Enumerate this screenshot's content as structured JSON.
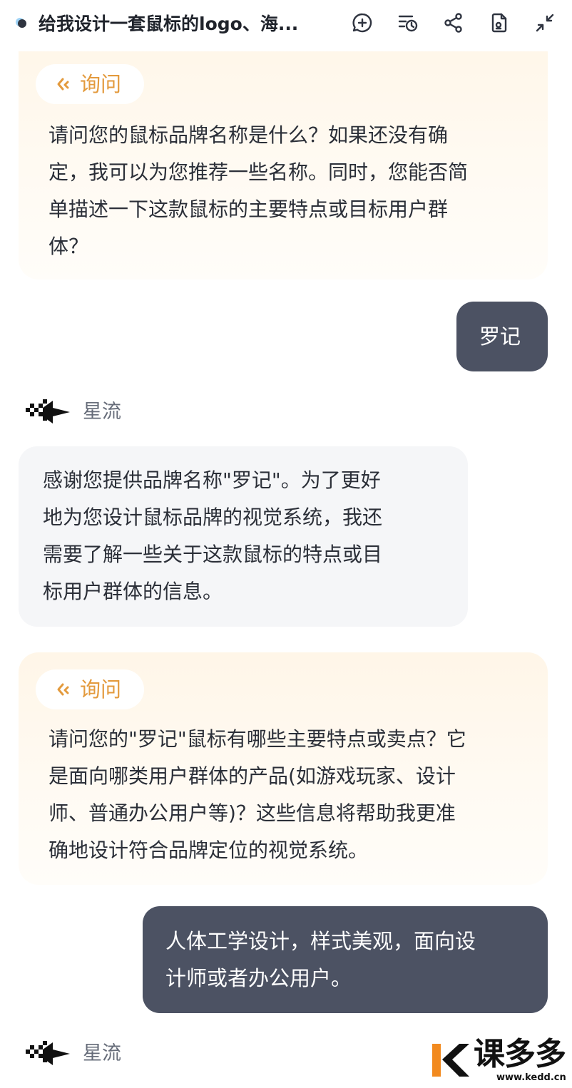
{
  "header": {
    "title": "给我设计一套鼠标的logo、海...",
    "icons": [
      "add-chat-icon",
      "history-icon",
      "share-icon",
      "document-icon",
      "collapse-icon"
    ]
  },
  "messages": {
    "ask1": {
      "badge": "询问",
      "lines": [
        "请问您的鼠标品牌名称是什么？如果还没有确",
        "定，我可以为您推荐一些名称。同时，您能否简",
        "单描述一下这款鼠标的主要特点或目标用户群",
        "体？"
      ]
    },
    "user1": {
      "lines": [
        "罗记"
      ]
    },
    "bot1": {
      "name": "星流",
      "lines": [
        "感谢您提供品牌名称\"罗记\"。为了更好",
        "地为您设计鼠标品牌的视觉系统，我还",
        "需要了解一些关于这款鼠标的特点或目",
        "标用户群体的信息。"
      ]
    },
    "ask2": {
      "badge": "询问",
      "lines": [
        "请问您的\"罗记\"鼠标有哪些主要特点或卖点？它",
        "是面向哪类用户群体的产品(如游戏玩家、设计",
        "师、普通办公用户等)？这些信息将帮助我更准",
        "确地设计符合品牌定位的视觉系统。"
      ]
    },
    "user2": {
      "lines": [
        "人体工学设计，样式美观，面向设",
        "计师或者办公用户。"
      ]
    },
    "bot2": {
      "name": "星流"
    }
  },
  "watermark": {
    "title": "课多多",
    "url": "www.kedd.cn"
  },
  "colors": {
    "accent": "#e39a3d",
    "user_bubble": "#4c5263",
    "bot_bubble": "#f5f6f8"
  }
}
